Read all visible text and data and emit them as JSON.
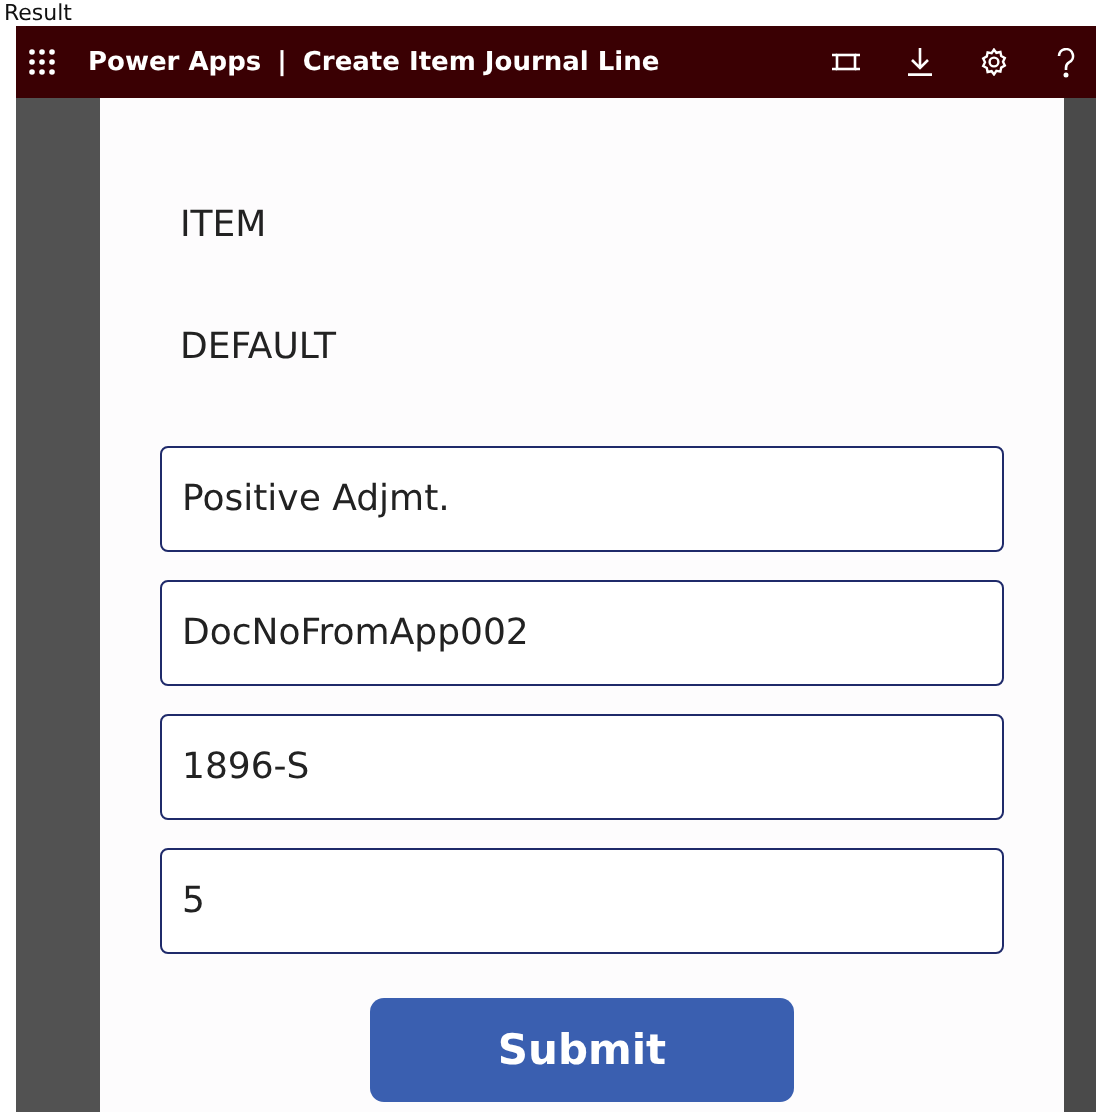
{
  "caption": "Result",
  "app_bar": {
    "app_name": "Power Apps",
    "separator": "|",
    "title": "Create Item Journal Line"
  },
  "labels": [
    "ITEM",
    "DEFAULT"
  ],
  "fields": [
    {
      "value": "Positive Adjmt."
    },
    {
      "value": "DocNoFromApp002"
    },
    {
      "value": "1896-S"
    },
    {
      "value": "5"
    }
  ],
  "submit_button": "Submit"
}
